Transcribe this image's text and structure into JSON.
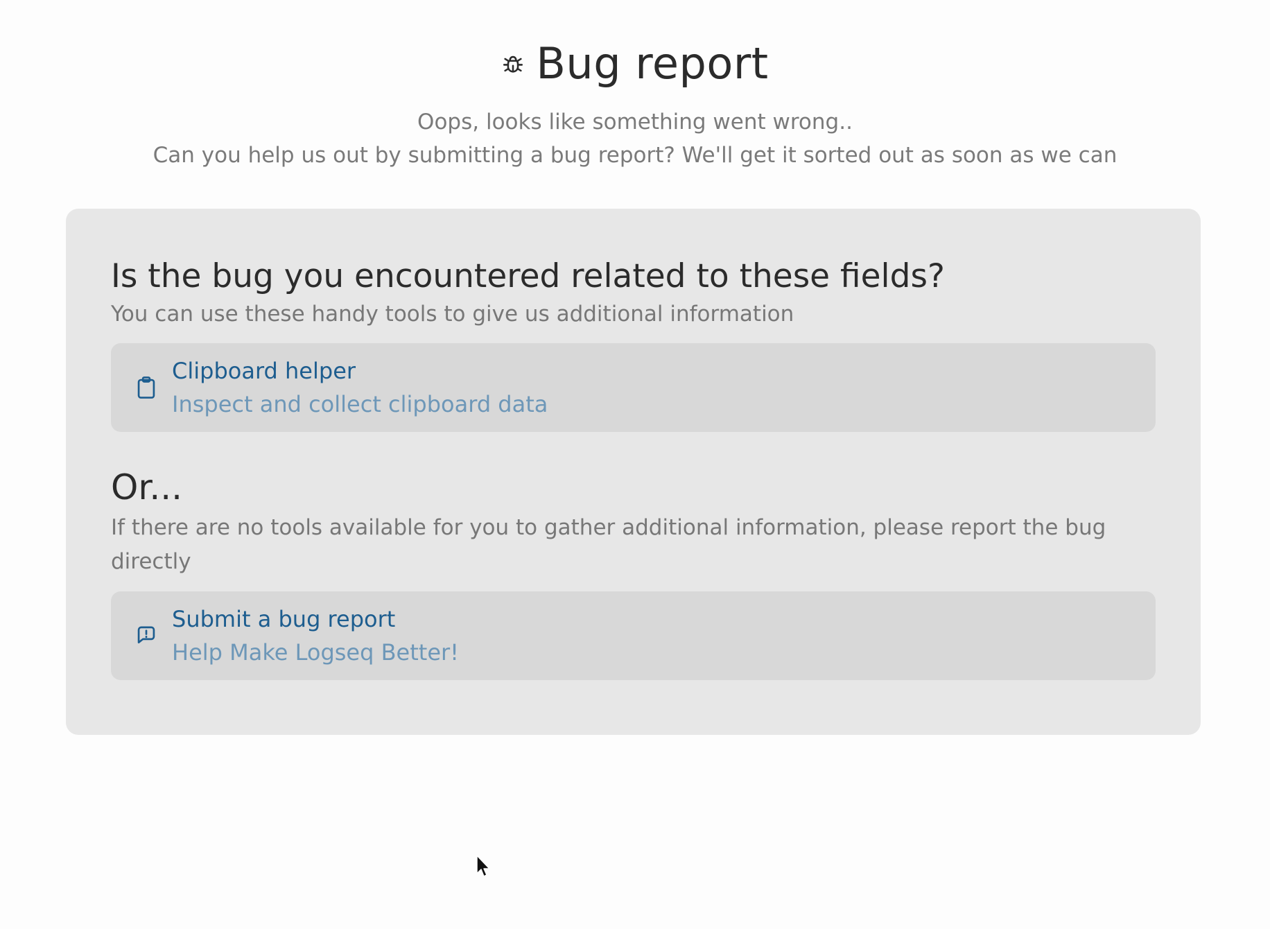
{
  "header": {
    "title": "Bug report",
    "subtitle_line1": "Oops, looks like something went wrong..",
    "subtitle_line2": "Can you help us out by submitting a bug report? We'll get it sorted out as soon as we can",
    "icon": "bug-icon"
  },
  "panel": {
    "heading": "Is the bug you encountered related to these fields?",
    "description": "You can use these handy tools to give us additional information",
    "tools": [
      {
        "title": "Clipboard helper",
        "subtitle": "Inspect and collect clipboard data",
        "icon": "clipboard-icon"
      }
    ],
    "or_heading": "Or...",
    "or_description": "If there are no tools available for you to gather additional information, please report the bug directly",
    "report": {
      "title": "Submit a bug report",
      "subtitle": "Help Make Logseq Better!",
      "icon": "message-report-icon"
    }
  },
  "colors": {
    "link": "#1d5d8f",
    "link_muted": "#6d97b8",
    "panel_bg": "#e7e7e7",
    "card_bg": "#d8d8d8"
  }
}
